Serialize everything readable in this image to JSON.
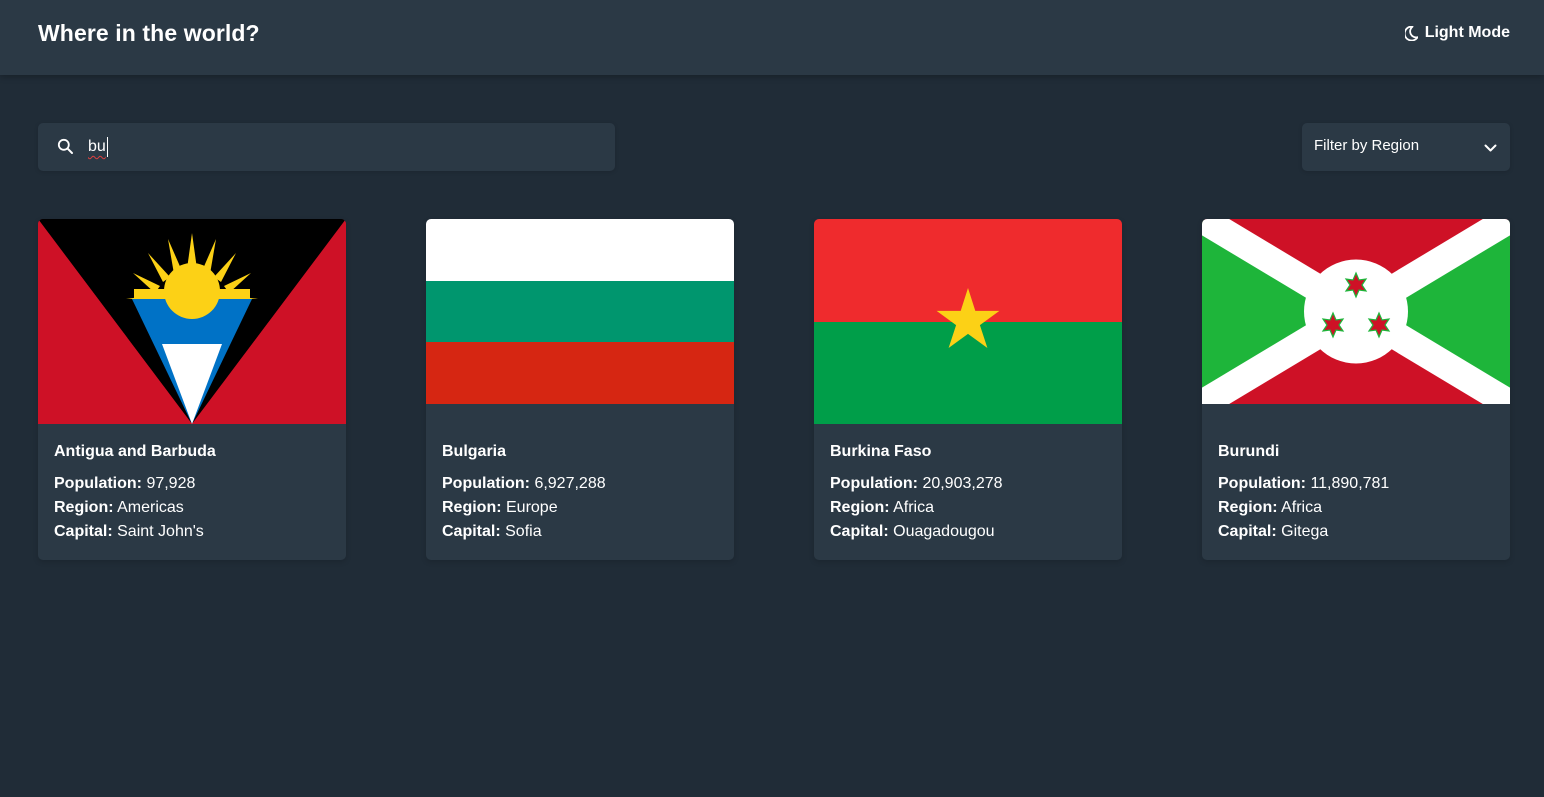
{
  "header": {
    "title": "Where in the world?",
    "theme_toggle_label": "Light Mode",
    "theme_icon": "moon-icon"
  },
  "search": {
    "value": "bu",
    "icon": "search-icon"
  },
  "filter": {
    "label": "Filter by Region",
    "icon": "chevron-down-icon"
  },
  "labels": {
    "population": "Population:",
    "region": "Region:",
    "capital": "Capital:"
  },
  "countries": [
    {
      "name": "Antigua and Barbuda",
      "population": "97,928",
      "region": "Americas",
      "capital": "Saint John's",
      "flag": "antigua-and-barbuda-flag"
    },
    {
      "name": "Bulgaria",
      "population": "6,927,288",
      "region": "Europe",
      "capital": "Sofia",
      "flag": "bulgaria-flag"
    },
    {
      "name": "Burkina Faso",
      "population": "20,903,278",
      "region": "Africa",
      "capital": "Ouagadougou",
      "flag": "burkina-faso-flag"
    },
    {
      "name": "Burundi",
      "population": "11,890,781",
      "region": "Africa",
      "capital": "Gitega",
      "flag": "burundi-flag"
    }
  ],
  "colors": {
    "background": "#202c37",
    "elements": "#2b3945",
    "text": "#ffffff"
  }
}
